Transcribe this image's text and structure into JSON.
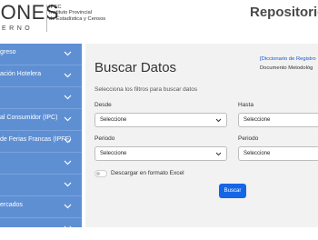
{
  "header": {
    "logo_text": "IONES",
    "logo_subtext": "ERNO",
    "org_lines": [
      "IPEC",
      "Instituto Provincial",
      "de Estadística y Censos"
    ],
    "site_title": "Repositorio"
  },
  "sidebar": {
    "items": [
      {
        "label": "greso"
      },
      {
        "label": "ación Hotelera"
      },
      {
        "label": ""
      },
      {
        "label": "al Consumidor (IPC)"
      },
      {
        "label": "de Ferias Francas (IPFF)"
      },
      {
        "label": ""
      },
      {
        "label": ""
      },
      {
        "label": "ercados"
      },
      {
        "label": ""
      }
    ]
  },
  "main": {
    "title": "Buscar Datos",
    "subtitle": "Selecciona los filtros para buscar datos",
    "dictionary_link": "[Diccionario de Registro",
    "doc_text": "Documento Metodológ",
    "filters": {
      "desde_label": "Desde",
      "hasta_label": "Hasta",
      "periodo_label_1": "Periodo",
      "periodo_label_2": "Periodo",
      "select_value": "Seleccione"
    },
    "toggle_label": "Descargar en formato Excel",
    "toggle_on": false,
    "search_button": "Buscar"
  },
  "colors": {
    "sidebar_bg": "#5f8fd3",
    "button_bg": "#1466e6",
    "link": "#1a56c4"
  }
}
